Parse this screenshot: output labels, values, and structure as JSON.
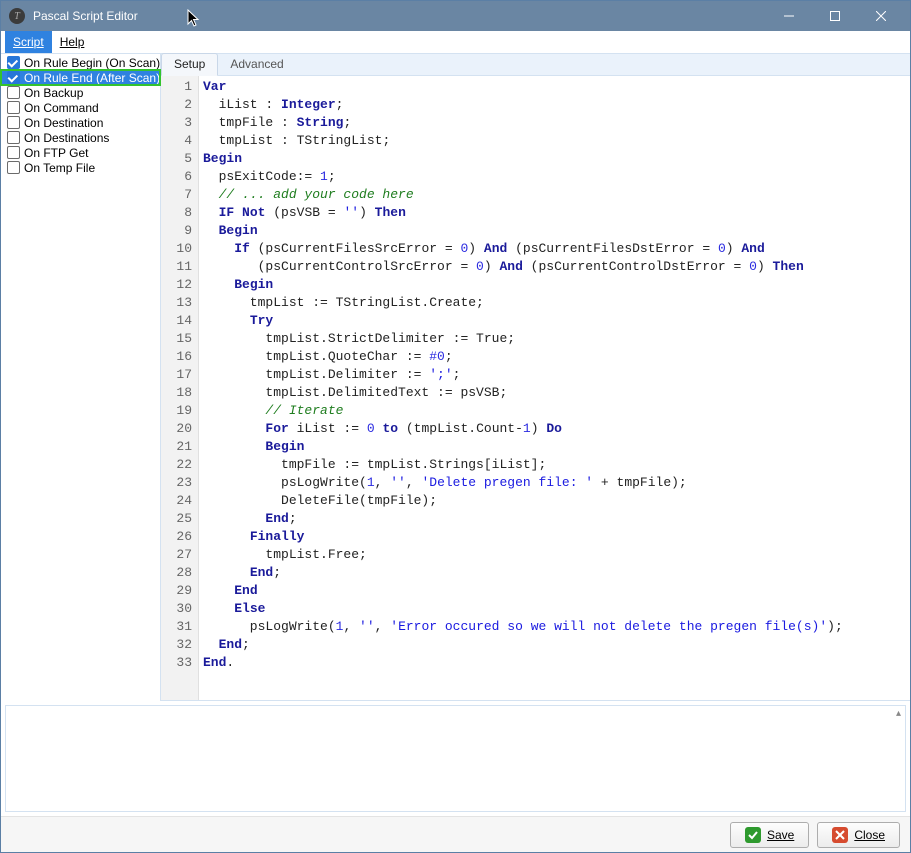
{
  "title": "Pascal Script Editor",
  "menu": {
    "script": "Script",
    "help": "Help"
  },
  "events": [
    {
      "label": "On Rule Begin (On Scan)",
      "checked": true,
      "selected": false
    },
    {
      "label": "On Rule End (After Scan)",
      "checked": true,
      "selected": true
    },
    {
      "label": "On Backup",
      "checked": false,
      "selected": false
    },
    {
      "label": "On Command",
      "checked": false,
      "selected": false
    },
    {
      "label": "On Destination",
      "checked": false,
      "selected": false
    },
    {
      "label": "On Destinations",
      "checked": false,
      "selected": false
    },
    {
      "label": "On FTP Get",
      "checked": false,
      "selected": false
    },
    {
      "label": "On Temp File",
      "checked": false,
      "selected": false
    }
  ],
  "tabs": {
    "setup": "Setup",
    "advanced": "Advanced",
    "active": "setup"
  },
  "buttons": {
    "save": "Save",
    "close": "Close"
  },
  "code_lines": [
    {
      "n": 1,
      "tokens": [
        [
          "kw",
          "Var"
        ]
      ]
    },
    {
      "n": 2,
      "tokens": [
        [
          "",
          "  iList"
        ],
        [
          "",
          " : "
        ],
        [
          "type",
          "Integer"
        ],
        [
          "",
          ";"
        ]
      ]
    },
    {
      "n": 3,
      "tokens": [
        [
          "",
          "  tmpFile"
        ],
        [
          "",
          " : "
        ],
        [
          "type",
          "String"
        ],
        [
          "",
          ";"
        ]
      ]
    },
    {
      "n": 4,
      "tokens": [
        [
          "",
          "  tmpList"
        ],
        [
          "",
          " : "
        ],
        [
          "",
          "TStringList"
        ],
        [
          "",
          ";"
        ]
      ]
    },
    {
      "n": 5,
      "tokens": [
        [
          "kw",
          "Begin"
        ]
      ]
    },
    {
      "n": 6,
      "tokens": [
        [
          "",
          "  psExitCode:= "
        ],
        [
          "num",
          "1"
        ],
        [
          "",
          ";"
        ]
      ]
    },
    {
      "n": 7,
      "tokens": [
        [
          "",
          "  "
        ],
        [
          "cmt",
          "// ... add your code here"
        ]
      ]
    },
    {
      "n": 8,
      "tokens": [
        [
          "",
          "  "
        ],
        [
          "kw",
          "IF"
        ],
        [
          "",
          " "
        ],
        [
          "kw",
          "Not"
        ],
        [
          "",
          " (psVSB = "
        ],
        [
          "str",
          "''"
        ],
        [
          "",
          ") "
        ],
        [
          "kw",
          "Then"
        ]
      ]
    },
    {
      "n": 9,
      "tokens": [
        [
          "",
          "  "
        ],
        [
          "kw",
          "Begin"
        ]
      ]
    },
    {
      "n": 10,
      "tokens": [
        [
          "",
          "    "
        ],
        [
          "kw",
          "If"
        ],
        [
          "",
          " (psCurrentFilesSrcError = "
        ],
        [
          "num",
          "0"
        ],
        [
          "",
          ") "
        ],
        [
          "kw",
          "And"
        ],
        [
          "",
          " (psCurrentFilesDstError = "
        ],
        [
          "num",
          "0"
        ],
        [
          "",
          ") "
        ],
        [
          "kw",
          "And"
        ]
      ]
    },
    {
      "n": 11,
      "tokens": [
        [
          "",
          "       (psCurrentControlSrcError = "
        ],
        [
          "num",
          "0"
        ],
        [
          "",
          ") "
        ],
        [
          "kw",
          "And"
        ],
        [
          "",
          " (psCurrentControlDstError = "
        ],
        [
          "num",
          "0"
        ],
        [
          "",
          ") "
        ],
        [
          "kw",
          "Then"
        ]
      ]
    },
    {
      "n": 12,
      "tokens": [
        [
          "",
          "    "
        ],
        [
          "kw",
          "Begin"
        ]
      ]
    },
    {
      "n": 13,
      "tokens": [
        [
          "",
          "      tmpList := TStringList.Create;"
        ]
      ]
    },
    {
      "n": 14,
      "tokens": [
        [
          "",
          "      "
        ],
        [
          "kw",
          "Try"
        ]
      ]
    },
    {
      "n": 15,
      "tokens": [
        [
          "",
          "        tmpList.StrictDelimiter := True;"
        ]
      ]
    },
    {
      "n": 16,
      "tokens": [
        [
          "",
          "        tmpList.QuoteChar := "
        ],
        [
          "num",
          "#0"
        ],
        [
          "",
          ";"
        ]
      ]
    },
    {
      "n": 17,
      "tokens": [
        [
          "",
          "        tmpList.Delimiter := "
        ],
        [
          "str",
          "';'"
        ],
        [
          "",
          ";"
        ]
      ]
    },
    {
      "n": 18,
      "tokens": [
        [
          "",
          "        tmpList.DelimitedText := psVSB;"
        ]
      ]
    },
    {
      "n": 19,
      "tokens": [
        [
          "",
          "        "
        ],
        [
          "cmt",
          "// Iterate"
        ]
      ]
    },
    {
      "n": 20,
      "tokens": [
        [
          "",
          "        "
        ],
        [
          "kw",
          "For"
        ],
        [
          "",
          " iList := "
        ],
        [
          "num",
          "0"
        ],
        [
          "",
          " "
        ],
        [
          "kw",
          "to"
        ],
        [
          "",
          " (tmpList.Count-"
        ],
        [
          "num",
          "1"
        ],
        [
          "",
          ") "
        ],
        [
          "kw",
          "Do"
        ]
      ]
    },
    {
      "n": 21,
      "tokens": [
        [
          "",
          "        "
        ],
        [
          "kw",
          "Begin"
        ]
      ]
    },
    {
      "n": 22,
      "tokens": [
        [
          "",
          "          tmpFile := tmpList.Strings[iList];"
        ]
      ]
    },
    {
      "n": 23,
      "tokens": [
        [
          "",
          "          psLogWrite("
        ],
        [
          "num",
          "1"
        ],
        [
          "",
          ", "
        ],
        [
          "str",
          "''"
        ],
        [
          "",
          ", "
        ],
        [
          "str",
          "'Delete pregen file: '"
        ],
        [
          "",
          " + tmpFile);"
        ]
      ]
    },
    {
      "n": 24,
      "tokens": [
        [
          "",
          "          DeleteFile(tmpFile);"
        ]
      ]
    },
    {
      "n": 25,
      "tokens": [
        [
          "",
          "        "
        ],
        [
          "kw",
          "End"
        ],
        [
          "",
          ";"
        ]
      ]
    },
    {
      "n": 26,
      "tokens": [
        [
          "",
          "      "
        ],
        [
          "kw",
          "Finally"
        ]
      ]
    },
    {
      "n": 27,
      "tokens": [
        [
          "",
          "        tmpList.Free;"
        ]
      ]
    },
    {
      "n": 28,
      "tokens": [
        [
          "",
          "      "
        ],
        [
          "kw",
          "End"
        ],
        [
          "",
          ";"
        ]
      ]
    },
    {
      "n": 29,
      "tokens": [
        [
          "",
          "    "
        ],
        [
          "kw",
          "End"
        ]
      ]
    },
    {
      "n": 30,
      "tokens": [
        [
          "",
          "    "
        ],
        [
          "kw",
          "Else"
        ]
      ]
    },
    {
      "n": 31,
      "tokens": [
        [
          "",
          "      psLogWrite("
        ],
        [
          "num",
          "1"
        ],
        [
          "",
          ", "
        ],
        [
          "str",
          "''"
        ],
        [
          "",
          ", "
        ],
        [
          "str",
          "'Error occured so we will not delete the pregen file(s)'"
        ],
        [
          "",
          ");"
        ]
      ]
    },
    {
      "n": 32,
      "tokens": [
        [
          "",
          "  "
        ],
        [
          "kw",
          "End"
        ],
        [
          "",
          ";"
        ]
      ]
    },
    {
      "n": 33,
      "tokens": [
        [
          "kw",
          "End"
        ],
        [
          "",
          "."
        ]
      ]
    }
  ]
}
